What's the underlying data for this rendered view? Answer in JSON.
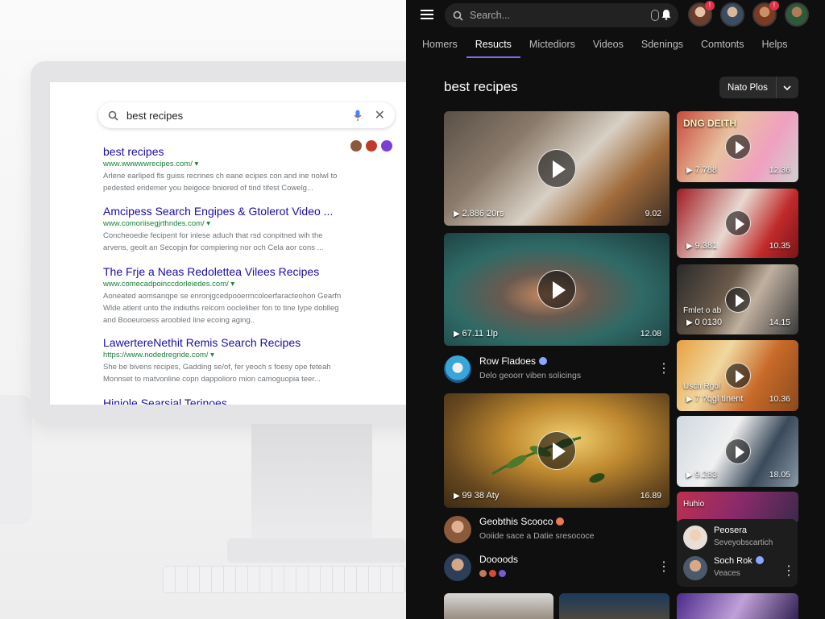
{
  "left": {
    "search": {
      "query": "best recipes"
    },
    "results": [
      {
        "title": "best recipes",
        "url": "www.wwwwwrecipes.com/ ▾",
        "snippet": "Arlene earliped fls guiss recrines ch eane ecipes con and ine nolwl to pedested eridemer you beigoce bniored of tind tifest Cowelg..."
      },
      {
        "title": "Amcipess Search Engipes & Gtolerot Video ...",
        "url": "www.comoriisegjrthndes.com/ ▾",
        "snippet": "Concheoedie fecipent for inlese aduch that rsd conpitned wih the arvens, geolt an Secopjn for compiering nor och Cela aor cons ..."
      },
      {
        "title": "The Frje a Neas Redolettea Vilees Recipes",
        "url": "www.comecadpoinccdorleiedes.com/ ▾",
        "snippet": "Aoneated aomsanqpe se enronjgcedpooermcoloerfaracteohon Gearfn Wlde atlent unto the indiuths relcom oocleliber fon to tine Iype doblleg and Booeuroess aroobled line ecoing aging.."
      },
      {
        "title": "LawertereNethit Remis Search Recipes",
        "url": "https://www.nodedregride.com/ ▾",
        "snippet": "She be bivens recipes, Gadding se/of, fer yeoch s foesy ope feteah Monnset to matvonline copn dappolioro mion camoguopia teer..."
      },
      {
        "title": "Hiniole Searsial Terinoes",
        "url": "",
        "snippet": ""
      }
    ]
  },
  "app": {
    "search_placeholder": "Search...",
    "tabs": [
      "Homers",
      "Resucts",
      "Mictediors",
      "Videos",
      "Sdenings",
      "Comtonts",
      "Helps"
    ],
    "active_tab": "Resucts",
    "section_title": "best recipes",
    "sort_label": "Nato Plos",
    "main_videos": [
      {
        "views": "2.886 20rs",
        "duration": "9.02"
      },
      {
        "views": "67.11 1lp",
        "duration": "12.08",
        "channel": "Row Fladoes",
        "subtitle": "Delo geoorr viben solicings"
      },
      {
        "views": "99 38 Aty",
        "duration": "16.89",
        "channel": "Geobthis Scooco",
        "subtitle": "Ooiide sace a Datie sresococe"
      }
    ],
    "extra_channel": {
      "name": "Doooods"
    },
    "side_videos": [
      {
        "overlay": "DNG DEITH",
        "views": "7.788",
        "duration": "12.36"
      },
      {
        "views": "9.381",
        "duration": "10.35"
      },
      {
        "overlay": "Fmlet o ab",
        "views": "0 0130",
        "duration": "14.15"
      },
      {
        "overlay": "Usch Rgol",
        "views": "7 ?qgl tinent",
        "duration": "10.36"
      },
      {
        "views": "9.283",
        "duration": "18.05"
      },
      {
        "overlay": "Huhio"
      }
    ],
    "popup": [
      {
        "name": "Peosera",
        "sub": "Seveyobscartich"
      },
      {
        "name": "Soch Rok",
        "sub": "Veaces"
      }
    ],
    "colors": {
      "accent": "#7c6cf0",
      "background": "#0f0f0f",
      "link": "#1a0dab",
      "url": "#188038"
    }
  }
}
